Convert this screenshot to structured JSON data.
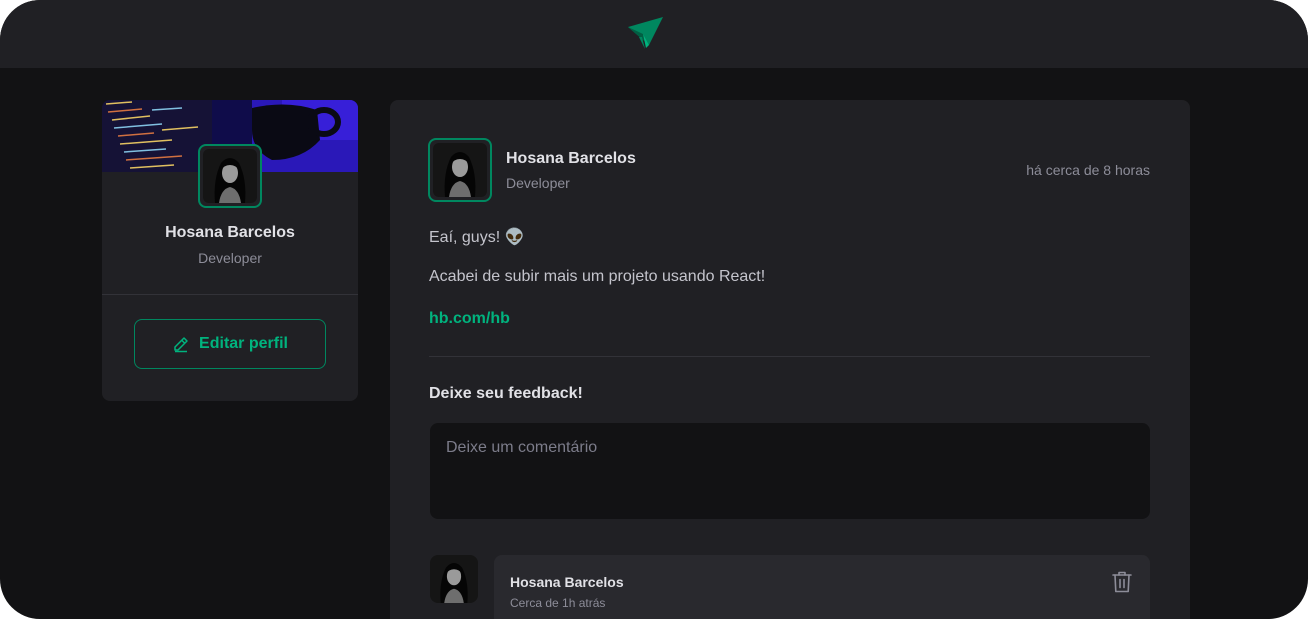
{
  "colors": {
    "background": "#121214",
    "surface": "#202024",
    "card": "#29292e",
    "brand": "#00875f",
    "brand_light": "#00b37e",
    "text_title": "#e1e1e6",
    "text_body": "#c4c4cc",
    "text_muted": "#8d8d99"
  },
  "header": {
    "logo_icon": "paper-plane-logo-icon"
  },
  "sidebar": {
    "name": "Hosana Barcelos",
    "role": "Developer",
    "edit_button": {
      "icon": "pencil-icon",
      "label": "Editar perfil"
    }
  },
  "post": {
    "author": {
      "name": "Hosana Barcelos",
      "role": "Developer"
    },
    "published_at": "há cerca de 8 horas",
    "content": {
      "greeting": "Eaí, guys! 👽",
      "body": "Acabei de subir mais um projeto usando React!",
      "link": "hb.com/hb"
    },
    "feedback": {
      "title": "Deixe seu feedback!",
      "placeholder": "Deixe um comentário"
    },
    "comments": [
      {
        "author": "Hosana Barcelos",
        "time": "Cerca de 1h atrás",
        "delete_icon": "trash-icon"
      }
    ]
  }
}
